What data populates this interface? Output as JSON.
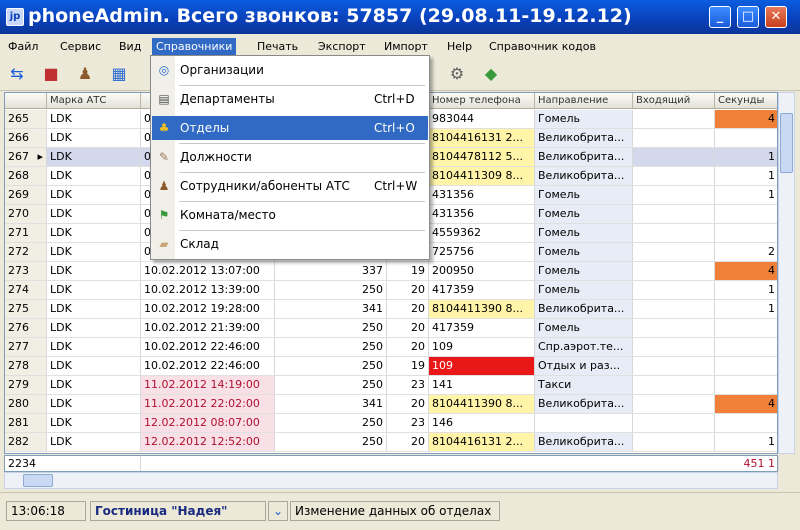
{
  "window": {
    "icon": "jp",
    "title": "phoneAdmin. Всего звонков: 57857 (29.08.11-19.12.12)",
    "min_label": "_",
    "max_label": "□",
    "close_label": "✕"
  },
  "menu": [
    "Файл",
    "Сервис",
    "Вид",
    "Справочники",
    "Печать",
    "Экспорт",
    "Импорт",
    "Help",
    "Справочник кодов"
  ],
  "dropdown": {
    "items": [
      {
        "icon": "organization-icon",
        "glyph": "◎",
        "label": "Организации",
        "shortcut": ""
      },
      {
        "icon": "department-icon",
        "glyph": "▤",
        "label": "Департаменты",
        "shortcut": "Ctrl+D"
      },
      {
        "icon": "group-icon",
        "glyph": "♣",
        "label": "Отделы",
        "shortcut": "Ctrl+O"
      },
      {
        "icon": "position-icon",
        "glyph": "✎",
        "label": "Должности",
        "shortcut": ""
      },
      {
        "icon": "person-icon",
        "glyph": "♟",
        "label": "Сотрудники/абоненты АТС",
        "shortcut": "Ctrl+W"
      },
      {
        "icon": "room-icon",
        "glyph": "⚑",
        "label": "Комната/место",
        "shortcut": ""
      },
      {
        "icon": "warehouse-icon",
        "glyph": "▰",
        "label": "Склад",
        "shortcut": ""
      }
    ]
  },
  "grid": {
    "headers": [
      "",
      "Марка АТС",
      "",
      "",
      "",
      "Номер телефона",
      "Направление",
      "Входящий",
      "Секунды"
    ],
    "rows": [
      {
        "n": "265",
        "ats": "LDK",
        "date": "0",
        "c1": "",
        "c2": "",
        "phone": "983044",
        "dir": "Гомель",
        "inc": "",
        "sec": "4",
        "sel": false,
        "bad": false,
        "phone_hl": "",
        "sec_hl": "orange"
      },
      {
        "n": "266",
        "ats": "LDK",
        "date": "0",
        "c1": "",
        "c2": "",
        "phone": "8104416131 2...",
        "dir": "Великобрита...",
        "inc": "",
        "sec": "",
        "sel": false,
        "bad": false,
        "phone_hl": "yellow",
        "sec_hl": ""
      },
      {
        "n": "267",
        "ats": "LDK",
        "date": "0",
        "c1": "",
        "c2": "",
        "phone": "8104478112 5...",
        "dir": "Великобрита...",
        "inc": "",
        "sec": "1",
        "sel": true,
        "bad": false,
        "phone_hl": "yellow",
        "sec_hl": ""
      },
      {
        "n": "268",
        "ats": "LDK",
        "date": "0",
        "c1": "",
        "c2": "",
        "phone": "8104411309 8...",
        "dir": "Великобрита...",
        "inc": "",
        "sec": "1",
        "sel": false,
        "bad": false,
        "phone_hl": "yellow",
        "sec_hl": ""
      },
      {
        "n": "269",
        "ats": "LDK",
        "date": "0",
        "c1": "",
        "c2": "",
        "phone": "431356",
        "dir": "Гомель",
        "inc": "",
        "sec": "1",
        "sel": false,
        "bad": false,
        "phone_hl": "",
        "sec_hl": ""
      },
      {
        "n": "270",
        "ats": "LDK",
        "date": "0",
        "c1": "",
        "c2": "",
        "phone": "431356",
        "dir": "Гомель",
        "inc": "",
        "sec": "",
        "sel": false,
        "bad": false,
        "phone_hl": "",
        "sec_hl": ""
      },
      {
        "n": "271",
        "ats": "LDK",
        "date": "0",
        "c1": "",
        "c2": "",
        "phone": "4559362",
        "dir": "Гомель",
        "inc": "",
        "sec": "",
        "sel": false,
        "bad": false,
        "phone_hl": "",
        "sec_hl": ""
      },
      {
        "n": "272",
        "ats": "LDK",
        "date": "0",
        "c1": "",
        "c2": "",
        "phone": "725756",
        "dir": "Гомель",
        "inc": "",
        "sec": "2",
        "sel": false,
        "bad": false,
        "phone_hl": "",
        "sec_hl": ""
      },
      {
        "n": "273",
        "ats": "LDK",
        "date": "10.02.2012 13:07:00",
        "c1": "337",
        "c2": "19",
        "phone": "200950",
        "dir": "Гомель",
        "inc": "",
        "sec": "4",
        "sel": false,
        "bad": false,
        "phone_hl": "",
        "sec_hl": "orange"
      },
      {
        "n": "274",
        "ats": "LDK",
        "date": "10.02.2012 13:39:00",
        "c1": "250",
        "c2": "20",
        "phone": "417359",
        "dir": "Гомель",
        "inc": "",
        "sec": "1",
        "sel": false,
        "bad": false,
        "phone_hl": "",
        "sec_hl": ""
      },
      {
        "n": "275",
        "ats": "LDK",
        "date": "10.02.2012 19:28:00",
        "c1": "341",
        "c2": "20",
        "phone": "8104411390 8...",
        "dir": "Великобрита...",
        "inc": "",
        "sec": "1",
        "sel": false,
        "bad": false,
        "phone_hl": "yellow",
        "sec_hl": ""
      },
      {
        "n": "276",
        "ats": "LDK",
        "date": "10.02.2012 21:39:00",
        "c1": "250",
        "c2": "20",
        "phone": "417359",
        "dir": "Гомель",
        "inc": "",
        "sec": "",
        "sel": false,
        "bad": false,
        "phone_hl": "",
        "sec_hl": ""
      },
      {
        "n": "277",
        "ats": "LDK",
        "date": "10.02.2012 22:46:00",
        "c1": "250",
        "c2": "20",
        "phone": "109",
        "dir": "Спр.аэрот.те...",
        "inc": "",
        "sec": "",
        "sel": false,
        "bad": false,
        "phone_hl": "",
        "sec_hl": ""
      },
      {
        "n": "278",
        "ats": "LDK",
        "date": "10.02.2012 22:46:00",
        "c1": "250",
        "c2": "19",
        "phone": "109",
        "dir": "Отдых и раз...",
        "inc": "",
        "sec": "",
        "sel": false,
        "bad": false,
        "phone_hl": "red",
        "sec_hl": ""
      },
      {
        "n": "279",
        "ats": "LDK",
        "date": "11.02.2012 14:19:00",
        "c1": "250",
        "c2": "23",
        "phone": "141",
        "dir": "Такси",
        "inc": "",
        "sec": "",
        "sel": false,
        "bad": true,
        "phone_hl": "",
        "sec_hl": ""
      },
      {
        "n": "280",
        "ats": "LDK",
        "date": "11.02.2012 22:02:00",
        "c1": "341",
        "c2": "20",
        "phone": "8104411390 8...",
        "dir": "Великобрита...",
        "inc": "",
        "sec": "4",
        "sel": false,
        "bad": true,
        "phone_hl": "yellow",
        "sec_hl": "orange"
      },
      {
        "n": "281",
        "ats": "LDK",
        "date": "12.02.2012 08:07:00",
        "c1": "250",
        "c2": "23",
        "phone": "146",
        "dir": "",
        "inc": "",
        "sec": "",
        "sel": false,
        "bad": true,
        "phone_hl": "",
        "sec_hl": ""
      },
      {
        "n": "282",
        "ats": "LDK",
        "date": "12.02.2012 12:52:00",
        "c1": "250",
        "c2": "20",
        "phone": "8104416131 2...",
        "dir": "Великобрита...",
        "inc": "",
        "sec": "1",
        "sel": false,
        "bad": true,
        "phone_hl": "yellow",
        "sec_hl": ""
      }
    ],
    "summary_count": "2234",
    "summary_total": "451 1"
  },
  "status": {
    "time": "13:06:18",
    "hotel": "Гостиница \"Надея\"",
    "message": "Изменение данных об отделах"
  },
  "colors": {
    "accent": "#316ac5",
    "title_bar": "#0a3fb8",
    "highlight_yellow": "#fff4a8",
    "highlight_red": "#e81818",
    "highlight_orange": "#f08038"
  }
}
